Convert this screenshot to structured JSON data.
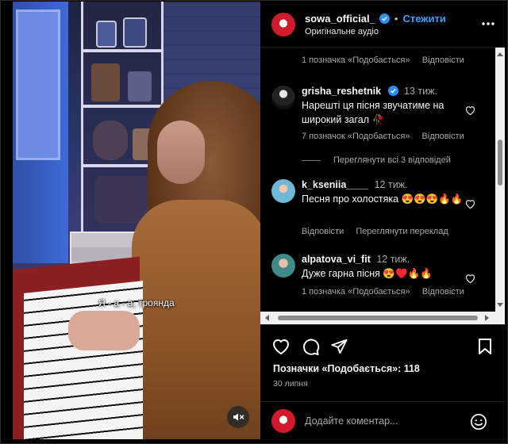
{
  "video": {
    "caption": "Я - а - а, троянда",
    "mute_icon": "muted-speaker-icon"
  },
  "header": {
    "username": "sowa_official_",
    "separator": "•",
    "follow_label": "Стежити",
    "audio_label": "Оригінальне аудіо",
    "more_icon": "more-horizontal-icon"
  },
  "comments": {
    "top_meta": {
      "likes": "1 позначка «Подобається»",
      "reply": "Відповісти"
    },
    "items": [
      {
        "user": "grisha_reshetnik",
        "verified": true,
        "time": "13 тиж.",
        "text": "Нарешті ця пісня звучатиме на широкий загал 🥀",
        "likes": "7 позначок «Подобається»",
        "reply": "Відповісти",
        "replies": "Переглянути всі 3 відповідей"
      },
      {
        "user": "k_kseniia____",
        "verified": false,
        "time": "12 тиж.",
        "text": "Песня про холостяка 😍😍😍🔥🔥",
        "reply": "Відповісти",
        "translate": "Переглянути переклад"
      },
      {
        "user": "alpatova_vi_fit",
        "verified": false,
        "time": "12 тиж.",
        "text": "Дуже гарна пісня 😍♥️🔥🔥",
        "likes": "1 позначка «Подобається»",
        "reply": "Відповісти"
      }
    ]
  },
  "actions": {
    "likes_text": "Позначки «Подобається»: 118",
    "date": "30 липня"
  },
  "composer": {
    "placeholder": "Додайте коментар..."
  },
  "colors": {
    "accent": "#3b9cff",
    "verified": "#2b8ef0",
    "brand_red": "#d11a2a"
  }
}
